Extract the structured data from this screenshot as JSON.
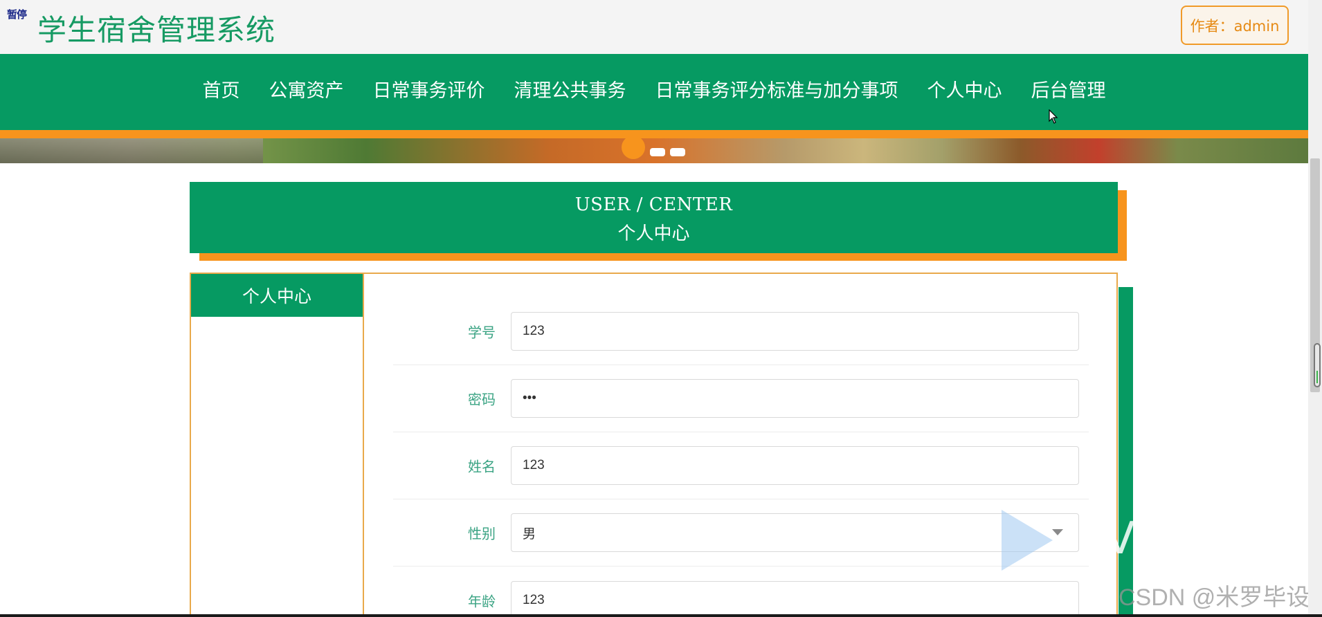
{
  "header": {
    "pause_tag": "暂停",
    "site_title": "学生宿舍管理系统",
    "author_label": "作者：admin"
  },
  "nav": {
    "items": [
      {
        "label": "首页"
      },
      {
        "label": "公寓资产"
      },
      {
        "label": "日常事务评价"
      },
      {
        "label": "清理公共事务"
      },
      {
        "label": "日常事务评分标准与加分事项"
      },
      {
        "label": "个人中心"
      },
      {
        "label": "后台管理"
      }
    ]
  },
  "carousel": {
    "slides": 3,
    "active_index": 0
  },
  "section": {
    "title_en": "USER / CENTER",
    "title_cn": "个人中心"
  },
  "sidebar": {
    "heading": "个人中心"
  },
  "form": {
    "fields": [
      {
        "label": "学号",
        "value": "123"
      },
      {
        "label": "密码",
        "value": "•••"
      },
      {
        "label": "姓名",
        "value": "123"
      },
      {
        "label": "性别",
        "value": "男"
      },
      {
        "label": "年龄",
        "value": "123"
      }
    ]
  },
  "watermark": {
    "csdn": "CSDN @米罗毕设",
    "letter": "V"
  },
  "colors": {
    "primary_green": "#069a62",
    "accent_orange": "#f7941d",
    "label_green": "#3aa383"
  }
}
